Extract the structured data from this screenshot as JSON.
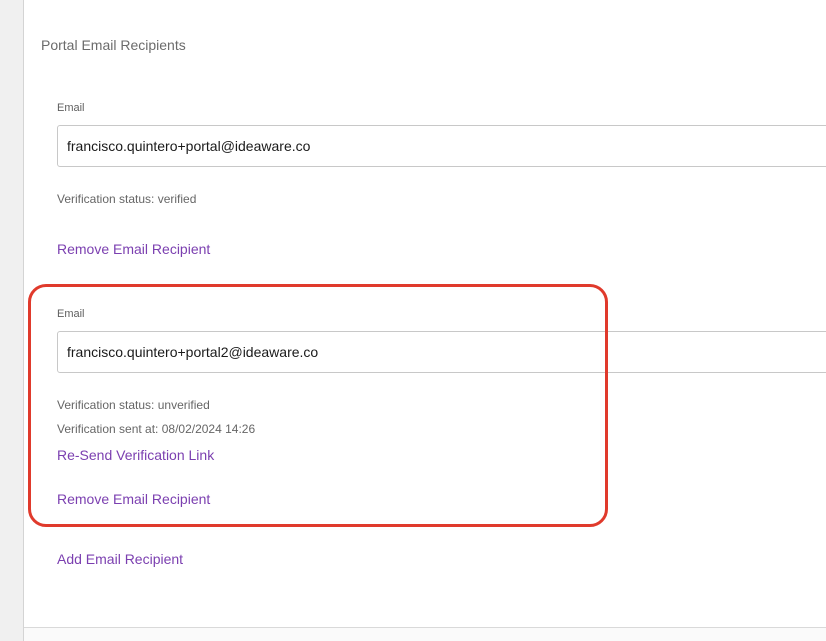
{
  "section": {
    "title": "Portal Email Recipients"
  },
  "recipients": [
    {
      "label": "Email",
      "value": "francisco.quintero+portal@ideaware.co",
      "status": "Verification status: verified",
      "remove_label": "Remove Email Recipient"
    },
    {
      "label": "Email",
      "value": "francisco.quintero+portal2@ideaware.co",
      "status": "Verification status: unverified",
      "sent_at": "Verification sent at: 08/02/2024 14:26",
      "resend_label": "Re-Send Verification Link",
      "remove_label": "Remove Email Recipient"
    }
  ],
  "add_label": "Add Email Recipient",
  "colors": {
    "link": "#7b3fb0",
    "highlight": "#e03a2c"
  }
}
